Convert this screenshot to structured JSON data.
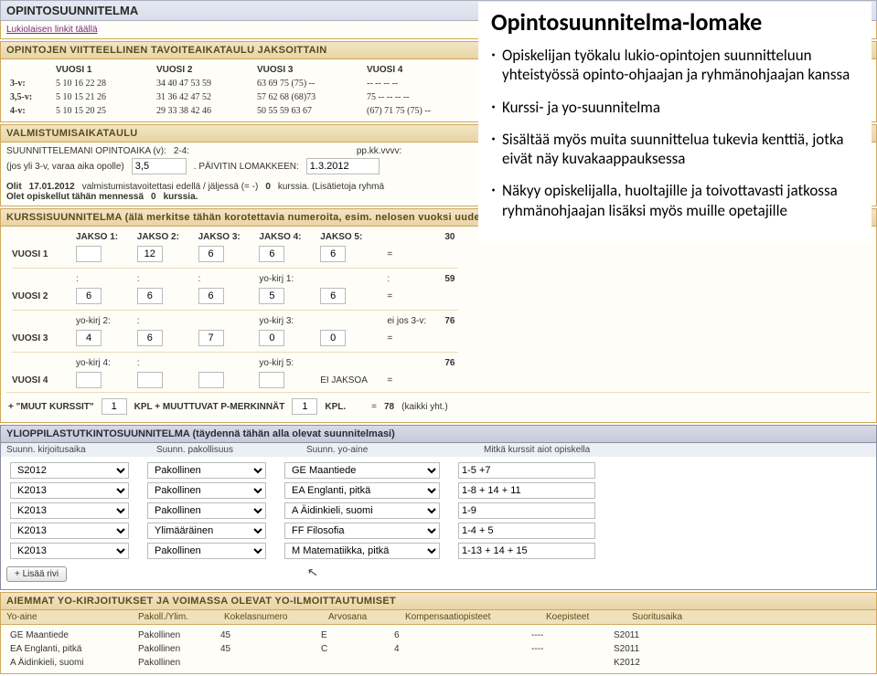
{
  "header": {
    "title": "OPINTOSUUNNITELMA"
  },
  "link_row": {
    "text": "Lukiolaisen linkit täällä"
  },
  "timetable": {
    "title": "OPINTOJEN VIITTEELLINEN TAVOITEAIKATAULU JAKSOITTAIN",
    "col_labels": [
      "",
      "VUOSI 1",
      "VUOSI 2",
      "VUOSI 3",
      "VUOSI 4"
    ],
    "rows": [
      {
        "label": "3-v:",
        "v1": "5 10 16 22 28",
        "v2": "34 40 47 53 59",
        "v3": "63 69 75 (75) --",
        "v4": "-- -- -- --"
      },
      {
        "label": "3,5-v:",
        "v1": "5 10 15 21 26",
        "v2": "31 36 42 47 52",
        "v3": "57 62 68 (68)73",
        "v4": "75 -- -- -- --"
      },
      {
        "label": "4-v:",
        "v1": "5 10 15 20 25",
        "v2": "29 33 38 42 46",
        "v3": "50 55 59 63 67",
        "v4": "(67) 71 75 (75) --"
      }
    ]
  },
  "valmistumis": {
    "title": "VALMISTUMISAIKATAULU",
    "labels": {
      "suunn": "SUUNNITTELEMANI OPINTOAIKA (v):",
      "opolle": "(jos yli 3-v, varaa aika opolle)",
      "ppkkvvvv": "pp.kk.vvvv:",
      "paivitin": ". PÄIVITIN LOMAKKEEN:"
    },
    "values": {
      "aika_v": "2-4:",
      "vuodet": "3,5",
      "pvm": "1.3.2012"
    },
    "olit": {
      "prefix": "Olit",
      "date": "17.01.2012",
      "mid1": "valmistumistavoitettasi edellä / jäljessä (= -)",
      "count1": "0",
      "suf1": "kurssia. (Lisätietoja ryhmä",
      "row2a": "Olet opiskellut tähän mennessä",
      "count2": "0",
      "suf2": "kurssia."
    }
  },
  "kurssi": {
    "title": "KURSSISUUNNITELMA (älä merkitse tähän korotettavia numeroita, esim. nelosen vuoksi uudelle",
    "jakso_header": [
      "JAKSO 1:",
      "JAKSO 2:",
      "JAKSO 3:",
      "JAKSO 4:",
      "JAKSO 5:",
      "",
      ""
    ],
    "jakso_sum": "30",
    "rows": [
      {
        "label": "VUOSI 1",
        "cells": [
          "",
          "12",
          "",
          "6",
          "",
          "6",
          "",
          "6",
          "",
          "="
        ],
        "sum": ""
      },
      {
        "label": "VUOSI 2",
        "sub1": ":",
        "cells": [
          "6",
          "",
          "6",
          "",
          "6",
          "",
          "yo-kirj 1:",
          "5",
          "",
          "6",
          "="
        ],
        "sum": "59"
      },
      {
        "label": "",
        "sub1": "yo-kirj 2:",
        "cells": [
          "",
          "",
          ":",
          "",
          "",
          "",
          "yo-kirj 3:",
          "",
          "ei jos 3-v:",
          "",
          "="
        ],
        "sum": "76"
      },
      {
        "label": "VUOSI 3",
        "cells": [
          "4",
          "",
          "6",
          "",
          "7",
          "",
          "0",
          "",
          "0",
          "",
          "="
        ],
        "sum": ""
      },
      {
        "label": "",
        "sub1": "yo-kirj 4:",
        "cells": [
          "",
          "",
          ":",
          "",
          "",
          "",
          "yo-kirj 5:",
          "",
          "",
          "",
          "="
        ],
        "sum": "76"
      },
      {
        "label": "VUOSI 4",
        "cells": [
          "",
          "",
          "",
          "",
          "",
          "",
          "",
          "",
          "EI JAKSOA",
          "",
          "="
        ],
        "sum": ""
      }
    ],
    "footer": {
      "plus": "+ \"MUUT KURSSIT\"",
      "v1": "1",
      "mid": "KPL + MUUTTUVAT P-MERKINNÄT",
      "v2": "1",
      "kpl": "KPL.",
      "eq": "=",
      "total": "78",
      "yht": "(kaikki yht.)"
    }
  },
  "ylio": {
    "title": "YLIOPPILASTUTKINTOSUUNNITELMA (täydennä tähän alla olevat suunnitelmasi)",
    "subhead": [
      "Suunn. kirjoitusaika",
      "Suunn. pakollisuus",
      "Suunn. yo-aine",
      "Mitkä kurssit aiot opiskella"
    ],
    "rows": [
      {
        "aika": "S2012",
        "pak": "Pakollinen",
        "aine": "GE Maantiede",
        "kurssit": "1-5 +7"
      },
      {
        "aika": "K2013",
        "pak": "Pakollinen",
        "aine": "EA Englanti, pitkä",
        "kurssit": "1-8 + 14 + 11"
      },
      {
        "aika": "K2013",
        "pak": "Pakollinen",
        "aine": "A Äidinkieli, suomi",
        "kurssit": "1-9"
      },
      {
        "aika": "K2013",
        "pak": "Ylimääräinen",
        "aine": "FF Filosofia",
        "kurssit": "1-4 + 5"
      },
      {
        "aika": "K2013",
        "pak": "Pakollinen",
        "aine": "M Matematiikka, pitkä",
        "kurssit": "1-13 + 14 + 15"
      }
    ],
    "add_row": "+ Lisää rivi"
  },
  "aiemmat": {
    "title": "AIEMMAT YO-KIRJOITUKSET JA VOIMASSA OLEVAT YO-ILMOITTAUTUMISET",
    "head": [
      "Yo-aine",
      "Pakoll./Ylim.",
      "Kokelasnumero",
      "Arvosana",
      "Kompensaatiopisteet",
      "Koepisteet",
      "Suoritusaika"
    ],
    "rows": [
      {
        "aine": "GE Maantiede",
        "pak": "Pakollinen",
        "nro": "45",
        "arv": "E",
        "komp": "6",
        "koep": "----",
        "aika": "S2011"
      },
      {
        "aine": "EA Englanti, pitkä",
        "pak": "Pakollinen",
        "nro": "45",
        "arv": "C",
        "komp": "4",
        "koep": "----",
        "aika": "S2011"
      },
      {
        "aine": "A Äidinkieli, suomi",
        "pak": "Pakollinen",
        "nro": "",
        "arv": "",
        "komp": "",
        "koep": "",
        "aika": "K2012"
      }
    ]
  },
  "callout": {
    "title": "Opintosuunnitelma-lomake",
    "items": [
      "Opiskelijan työkalu lukio-opintojen suunnitteluun yhteistyössä opinto-ohjaajan ja ryhmänohjaajan kanssa",
      "Kurssi- ja yo-suunnitelma",
      "Sisältää myös muita suunnittelua tukevia kenttiä, jotka eivät näy kuvakaappauksessa",
      "Näkyy opiskelijalla, huoltajille ja toivottavasti jatkossa ryhmänohjaajan lisäksi myös muille opetajille"
    ]
  }
}
